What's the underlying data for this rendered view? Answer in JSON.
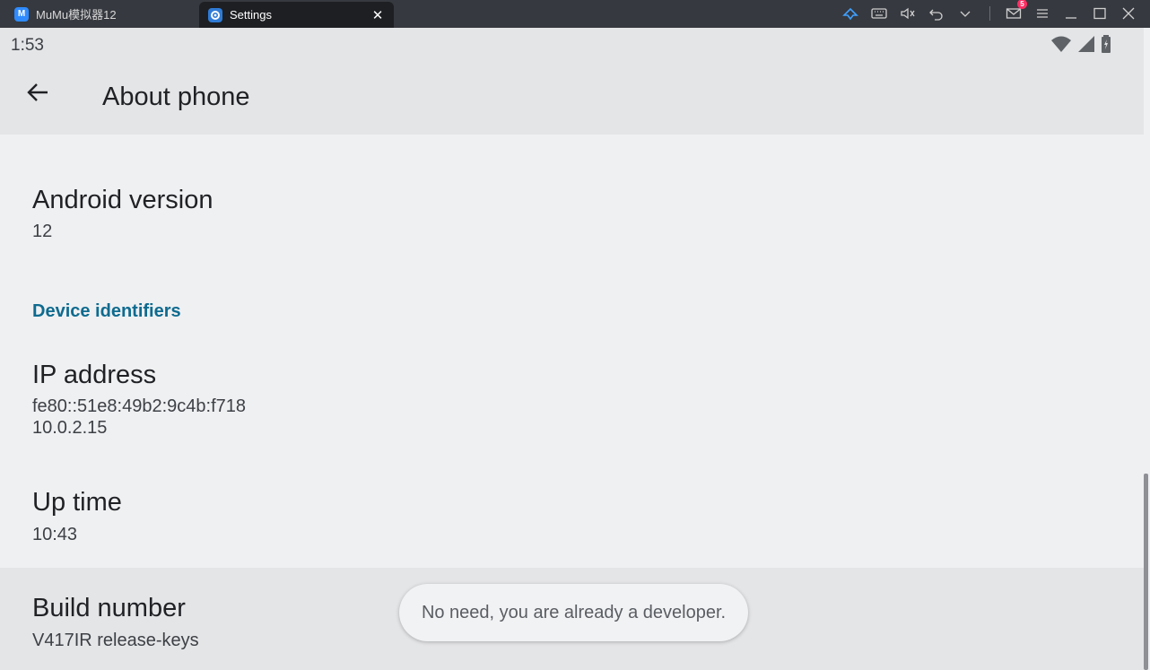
{
  "emulator": {
    "tabs": [
      {
        "label": "MuMu模拟器12"
      },
      {
        "label": "Settings"
      }
    ],
    "mail_badge_count": "5",
    "icons": [
      "shuttle-icon",
      "keyboard-icon",
      "mute-icon",
      "undo-icon",
      "chevron-down-icon",
      "mail-icon",
      "menu-icon",
      "minimize-icon",
      "maximize-icon",
      "close-icon"
    ]
  },
  "status_bar": {
    "time": "1:53",
    "icons": [
      "wifi-icon",
      "signal-icon",
      "battery-charging-icon"
    ]
  },
  "app_bar": {
    "title": "About phone"
  },
  "preferences": {
    "android_version": {
      "title": "Android version",
      "summary": "12"
    },
    "category": "Device identifiers",
    "ip_address": {
      "title": "IP address",
      "summary": "fe80::51e8:49b2:9c4b:f718\n10.0.2.15"
    },
    "up_time": {
      "title": "Up time",
      "summary": "10:43"
    },
    "build_number": {
      "title": "Build number",
      "summary": "V417IR release-keys"
    }
  },
  "toast": {
    "message": "No need, you are already a developer."
  },
  "colors": {
    "accent": "#0e6b8f",
    "titlebar": "#36393f",
    "badge": "#ff2e63"
  }
}
